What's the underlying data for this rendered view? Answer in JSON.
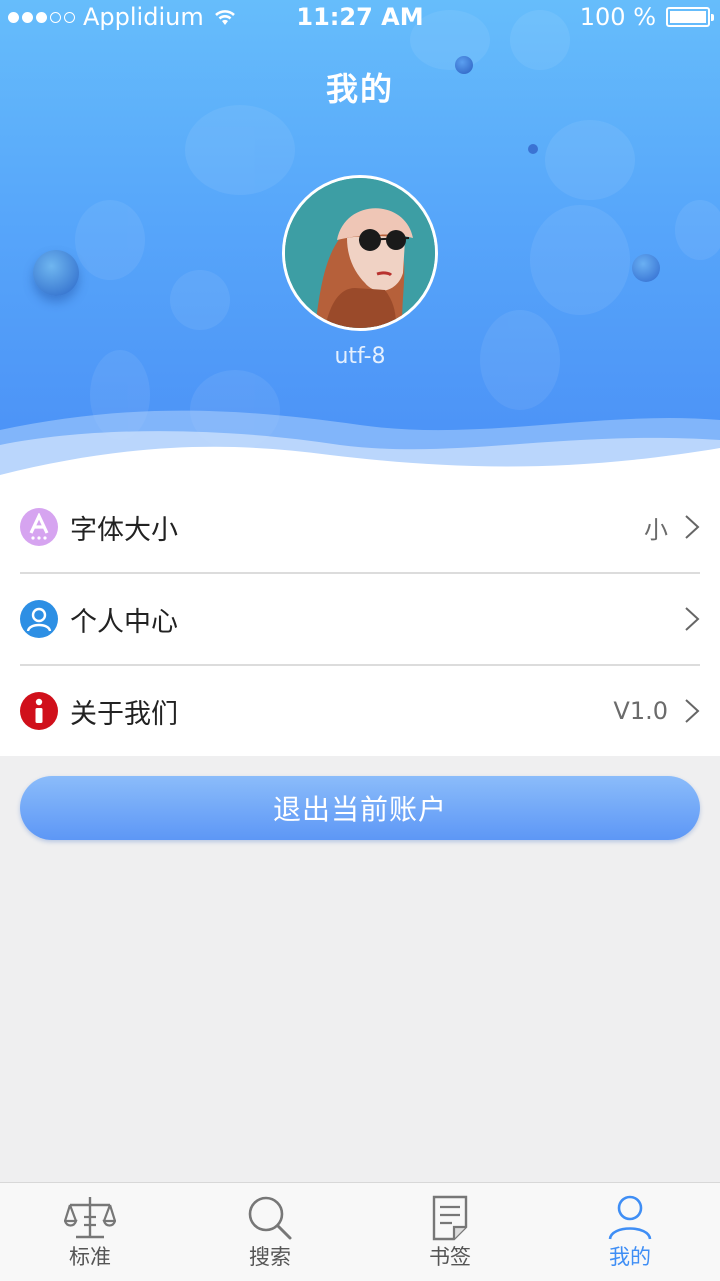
{
  "status_bar": {
    "carrier": "Applidium",
    "time": "11:27 AM",
    "battery": "100 %"
  },
  "header": {
    "title": "我的",
    "username": "utf-8"
  },
  "settings": [
    {
      "label": "字体大小",
      "value": "小",
      "icon": "font-size-icon",
      "color": "#d6a4f0"
    },
    {
      "label": "个人中心",
      "value": "",
      "icon": "user-icon",
      "color": "#2d8fe4"
    },
    {
      "label": "关于我们",
      "value": "V1.0",
      "icon": "info-icon",
      "color": "#d0101b"
    }
  ],
  "logout_label": "退出当前账户",
  "tabs": [
    {
      "label": "标准",
      "icon": "scale-icon"
    },
    {
      "label": "搜索",
      "icon": "search-icon"
    },
    {
      "label": "书签",
      "icon": "bookmark-icon"
    },
    {
      "label": "我的",
      "icon": "person-icon",
      "active": true
    }
  ],
  "colors": {
    "accent": "#3f8ef5",
    "header_top": "#66bdfb",
    "header_bottom": "#4a8ff6"
  }
}
